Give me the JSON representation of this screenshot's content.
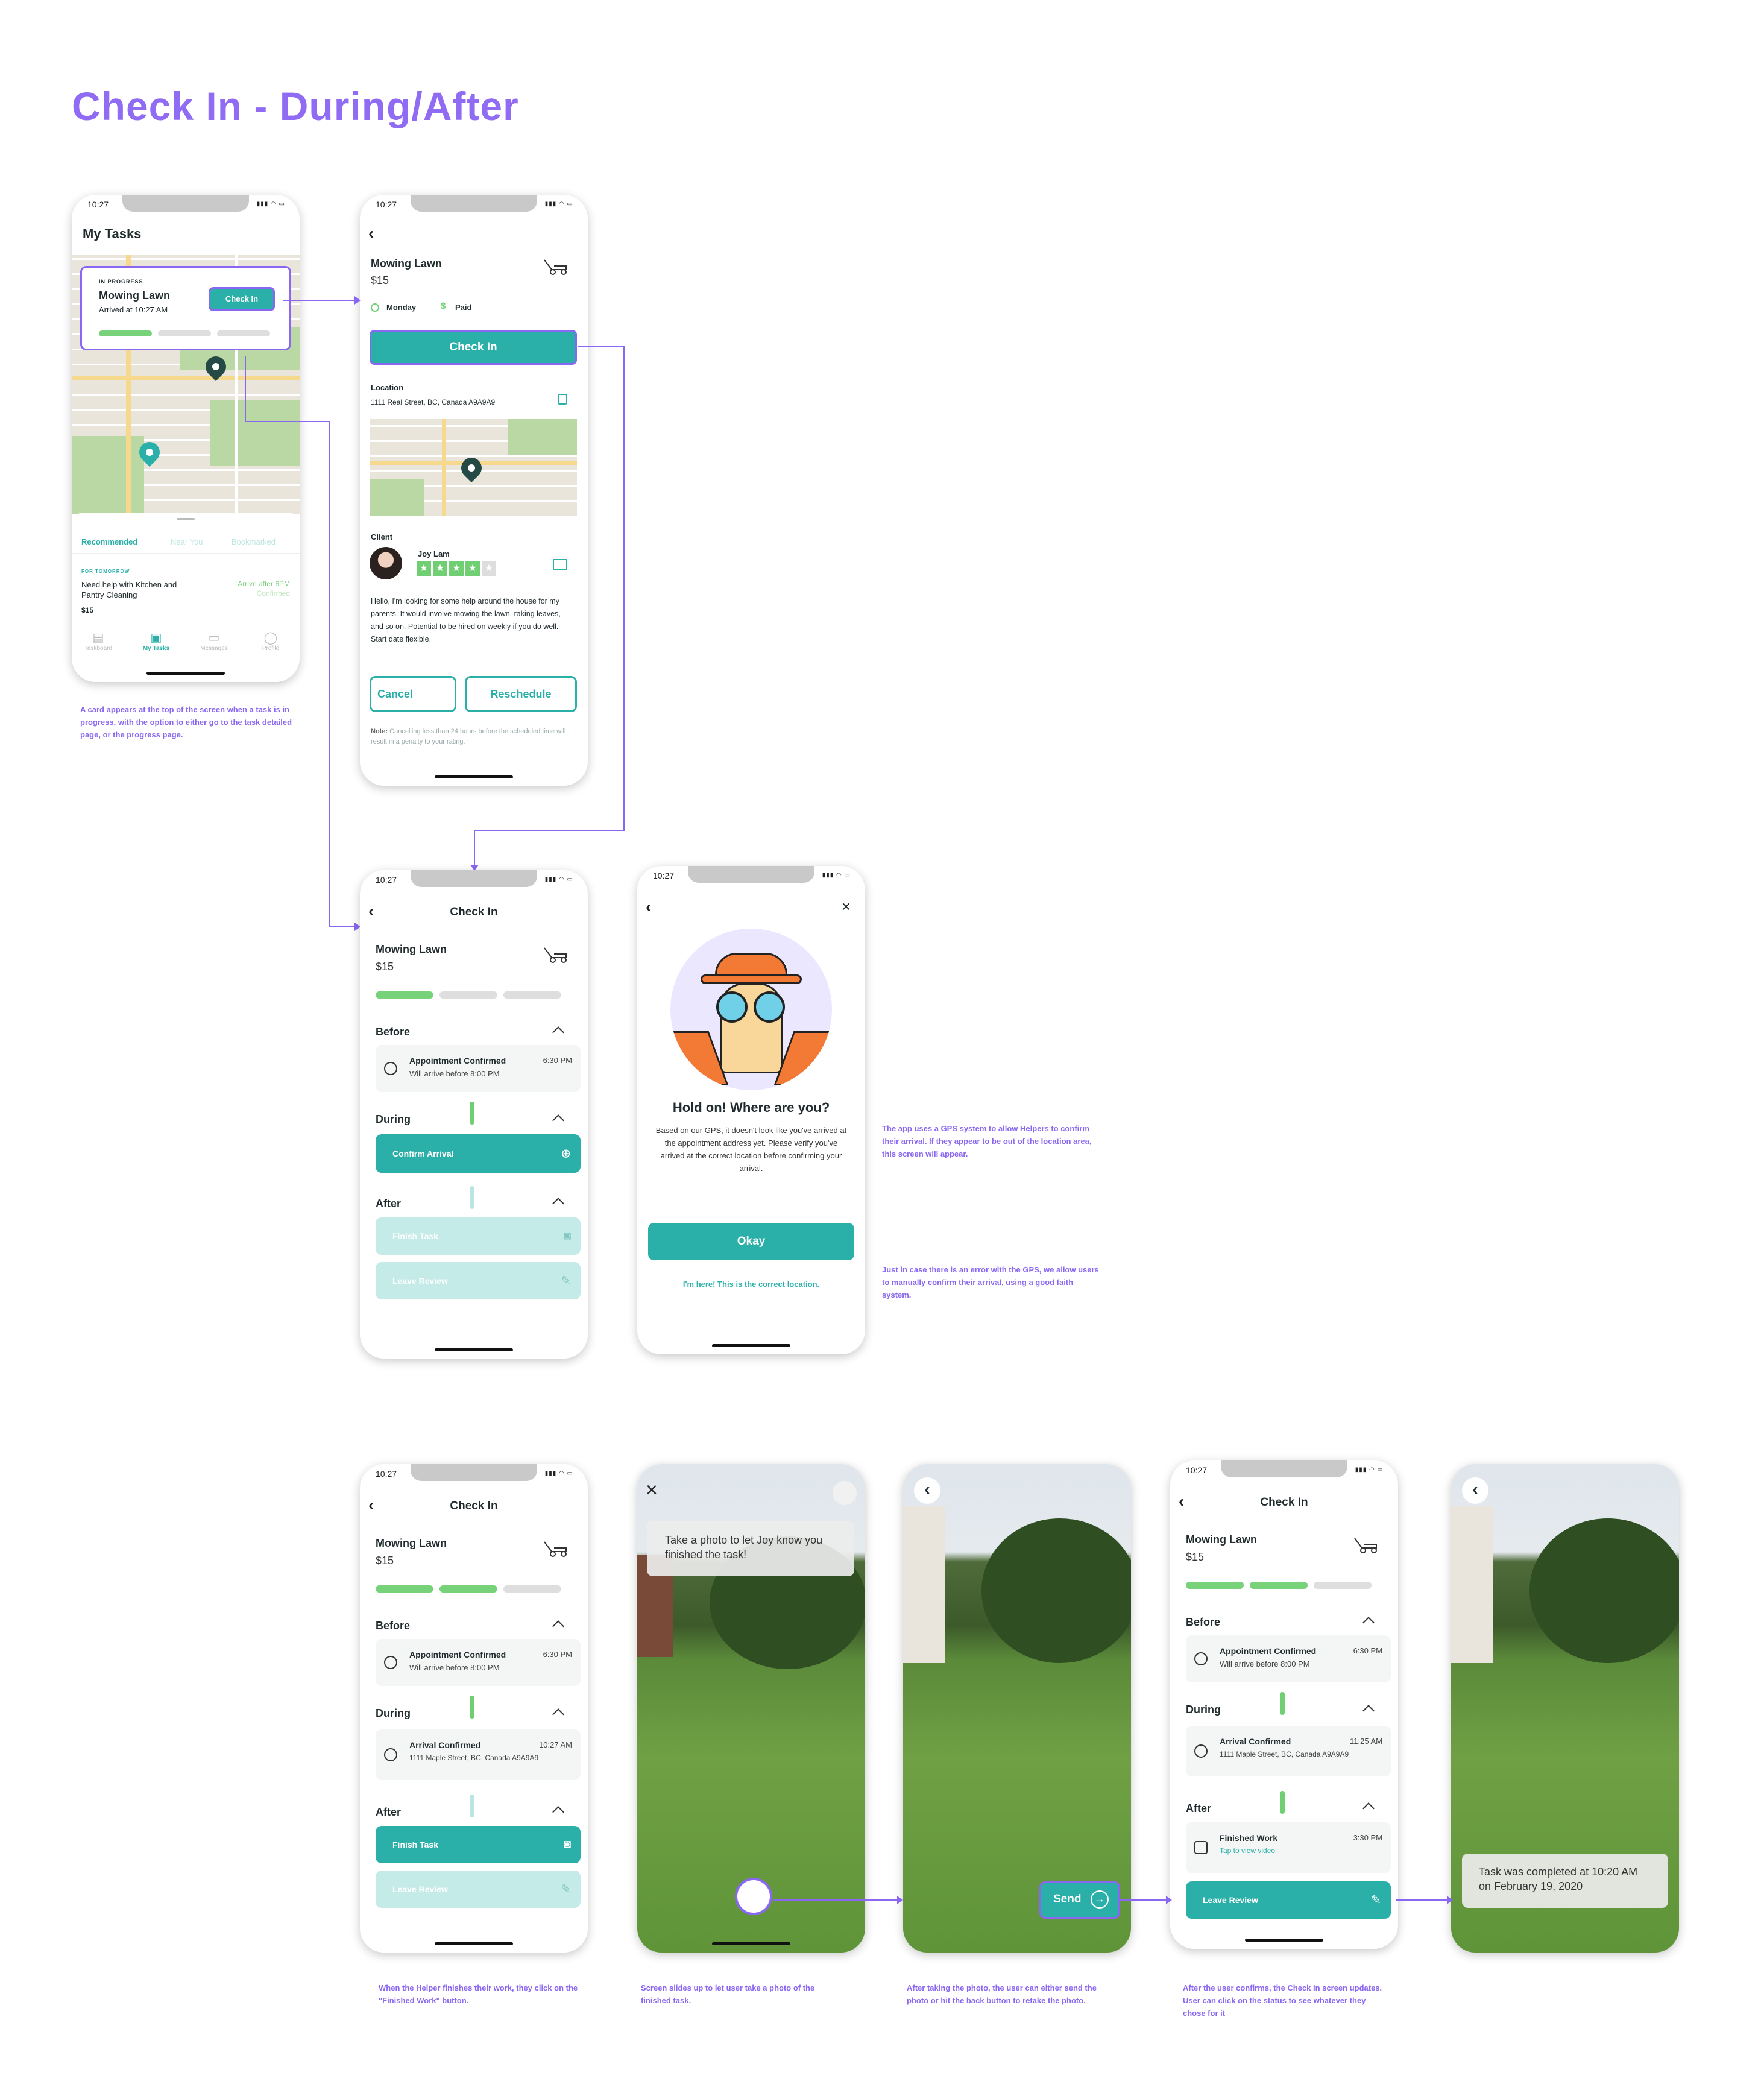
{
  "page": {
    "title": "Check In - During/After"
  },
  "status_time": "10:27",
  "my_tasks": {
    "title": "My Tasks",
    "inprogress_label": "IN PROGRESS",
    "task_name": "Mowing Lawn",
    "arrived": "Arrived at 10:27 AM",
    "checkin_btn": "Check In",
    "tabs": [
      "Recommended",
      "Near You",
      "Bookmarked"
    ],
    "for_tomorrow": "FOR TOMORROW",
    "task2": "Need help with Kitchen and Pantry Cleaning",
    "task2_price": "$15",
    "task2_time": "Arrive after 6PM",
    "task2_status": "Confirmed",
    "nav": [
      "Taskboard",
      "My Tasks",
      "Messages",
      "Profile"
    ]
  },
  "detail": {
    "task_name": "Mowing Lawn",
    "price": "$15",
    "day": "Monday",
    "paid": "Paid",
    "checkin_btn": "Check In",
    "location_label": "Location",
    "address": "1111 Real Street, BC, Canada A9A9A9",
    "client_label": "Client",
    "client_name": "Joy Lam",
    "description": "Hello, I'm looking for some help around the house for my parents. It would involve mowing the lawn, raking leaves, and so on. Potential to be hired on weekly if you do well. Start date flexible.",
    "cancel_btn": "Cancel",
    "reschedule_btn": "Reschedule",
    "note_bold": "Note:",
    "note": " Cancelling less than 24 hours before the scheduled time will result in a penalty to your rating."
  },
  "checkin": {
    "header": "Check In",
    "task_name": "Mowing Lawn",
    "price": "$15",
    "before": "Before",
    "during": "During",
    "after": "After",
    "appt_title": "Appointment Confirmed",
    "appt_sub": "Will arrive before 8:00 PM",
    "appt_time": "6:30 PM",
    "confirm_arrival": "Confirm Arrival",
    "finish_task": "Finish Task",
    "leave_review": "Leave Review",
    "arrival_title": "Arrival Confirmed",
    "arrival_sub": "1111 Maple Street, BC, Canada A9A9A9",
    "arrival_time_a": "10:27 AM",
    "arrival_time_b": "11:25 AM",
    "finished_title": "Finished Work",
    "finished_sub": "Tap to view video",
    "finished_time": "3:30 PM"
  },
  "hold_on": {
    "heading": "Hold on! Where are you?",
    "body": "Based on our GPS, it doesn't look like you've arrived at the appointment address yet. Please verify you've arrived at the correct location before confirming your arrival.",
    "okay_btn": "Okay",
    "here_link": "I'm here! This is the correct location."
  },
  "camera": {
    "prompt": "Take a photo to let Joy know you finished the task!",
    "send_btn": "Send",
    "completed": "Task was completed at 10:20 AM on February 19, 2020"
  },
  "notes": {
    "n1": "A card appears at the top of the screen when a task is in progress, with the option to either go to the task detailed page, or the progress page.",
    "n2": "The app uses a GPS system to allow Helpers to confirm their arrival. If they appear to be out of the location area, this screen will appear.",
    "n3": "Just in case there is an error with the GPS, we allow users to manually confirm their arrival, using a good faith system.",
    "n4": "When the Helper finishes their work, they click on the \"Finished Work\" button.",
    "n5": "Screen slides up to let user take a photo of the finished task.",
    "n6": "After taking the photo, the user can either send the photo or hit the back button to retake the photo.",
    "n7": "After the user confirms, the Check In screen updates. User can click on the status to see whatever they chose for it"
  },
  "colors": {
    "accent": "#2bb0a9",
    "annotation": "#8a67f2",
    "progress": "#78d27a"
  }
}
